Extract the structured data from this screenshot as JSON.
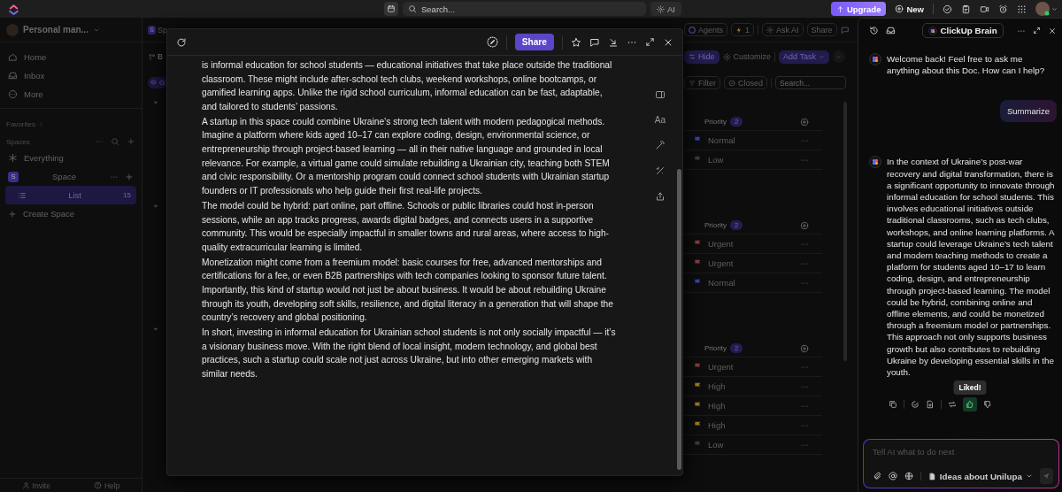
{
  "top_bar": {
    "search": {
      "placeholder": "Search..."
    },
    "ai_button": "AI",
    "upgrade_button": "Upgrade",
    "new_button": "New"
  },
  "sidebar": {
    "workspace": "Personal man...",
    "nav": [
      {
        "label": "Home",
        "kind": "home"
      },
      {
        "label": "Inbox",
        "kind": "inbox"
      },
      {
        "label": "More",
        "kind": "more"
      }
    ],
    "favorites": "Favorites",
    "spaces_label": "Spaces",
    "items": [
      {
        "label": "Everything",
        "kind": "everything",
        "selected": false
      },
      {
        "label": "Space",
        "kind": "space",
        "badge": "S",
        "selected": false
      },
      {
        "label": "List",
        "kind": "list",
        "count": "15",
        "selected": true
      },
      {
        "label": "Create Space",
        "kind": "create",
        "selected": false
      }
    ],
    "footer": [
      {
        "label": "Invite",
        "kind": "invite"
      },
      {
        "label": "Help",
        "kind": "help"
      }
    ]
  },
  "list_view": {
    "breadcrumb": {
      "badge": "S",
      "text": "Sp"
    },
    "toolbar_cut": "B",
    "group_chip": "G",
    "agents": "Agents",
    "automations_count": "1",
    "ask_ai": "Ask AI",
    "share": "Share",
    "hide": "Hide",
    "customize": "Customize",
    "add_task": "Add Task",
    "filter": "Filter",
    "closed": "Closed",
    "search": {
      "placeholder": "Search..."
    },
    "groups": [
      {
        "column": "Priority",
        "count": "2",
        "rows": [
          {
            "priority": "Normal",
            "color": "#3444b4"
          },
          {
            "priority": "Low",
            "color": "#3c3c3c"
          }
        ]
      },
      {
        "column": "Priority",
        "count": "2",
        "rows": [
          {
            "priority": "Urgent",
            "color": "#8c3c3c"
          },
          {
            "priority": "Urgent",
            "color": "#8c3c3c"
          },
          {
            "priority": "Normal",
            "color": "#3444b4"
          }
        ]
      },
      {
        "column": "Priority",
        "count": "2",
        "rows": [
          {
            "priority": "Urgent",
            "color": "#8c3c3c"
          },
          {
            "priority": "High",
            "color": "#a07c1c"
          },
          {
            "priority": "High",
            "color": "#a07c1c"
          },
          {
            "priority": "High",
            "color": "#a07c1c"
          },
          {
            "priority": "Low",
            "color": "#3c3c3c"
          }
        ]
      }
    ]
  },
  "doc": {
    "share_button": "Share",
    "format_button": "Aa",
    "paragraphs": [
      "is informal education for school students — educational initiatives that take place outside the traditional classroom. These might include after-school tech clubs, weekend workshops, online bootcamps, or gamified learning apps. Unlike the rigid school curriculum, informal education can be fast, adaptable, and tailored to students’ passions.",
      "A startup in this space could combine Ukraine’s strong tech talent with modern pedagogical methods. Imagine a platform where kids aged 10–17 can explore coding, design, environmental science, or entrepreneurship through project-based learning — all in their native language and grounded in local relevance. For example, a virtual game could simulate rebuilding a Ukrainian city, teaching both STEM and civic responsibility. Or a mentorship program could connect school students with Ukrainian startup founders or IT professionals who help guide their first real-life projects.",
      "The model could be hybrid: part online, part offline. Schools or public libraries could host in-person sessions, while an app tracks progress, awards digital badges, and connects users in a supportive community. This would be especially impactful in smaller towns and rural areas, where access to high-quality extracurricular learning is limited.",
      "Monetization might come from a freemium model: basic courses for free, advanced mentorships and certifications for a fee, or even B2B partnerships with tech companies looking to sponsor future talent. Importantly, this kind of startup would not just be about business. It would be about rebuilding Ukraine through its youth, developing soft skills, resilience, and digital literacy in a generation that will shape the country’s recovery and global positioning.",
      "In short, investing in informal education for Ukrainian school students is not only socially impactful — it’s a visionary business move. With the right blend of local insight, modern technology, and global best practices, such a startup could scale not just across Ukraine, but into other emerging markets with similar needs."
    ]
  },
  "brain": {
    "title": "ClickUp Brain",
    "messages": [
      {
        "kind": "assistant",
        "text": "Welcome back! Feel free to ask me anything about this Doc. How can I help?"
      },
      {
        "kind": "user",
        "text": "Summarize"
      },
      {
        "kind": "assistant",
        "text": "In the context of Ukraine’s post-war recovery and digital transformation, there is a significant opportunity to innovate through informal education for school students. This involves educational initiatives outside traditional classrooms, such as tech clubs, workshops, and online learning platforms. A startup could leverage Ukraine’s tech talent and modern teaching methods to create a platform for students aged 10–17 to learn coding, design, and entrepreneurship through project-based learning. The model could be hybrid, combining online and offline elements, and could be monetized through a freemium model or partnerships. This approach not only supports business growth but also contributes to rebuilding Ukraine by developing essential skills in the youth.",
        "actions": {
          "liked": true,
          "tooltip": "Liked!"
        }
      }
    ],
    "input": {
      "placeholder": "Tell AI what to do next",
      "context": "Ideas about Unilupa"
    }
  }
}
